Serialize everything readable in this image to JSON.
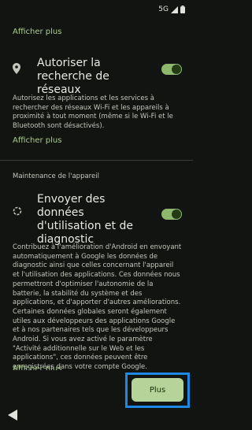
{
  "status_bar": {
    "network": "5G"
  },
  "links": {
    "show_more_top": "Afficher plus",
    "show_more_mid": "Afficher plus",
    "show_more_bottom": "Afficher plus"
  },
  "network_scan": {
    "title": "Autoriser la recherche de réseaux",
    "enabled": true,
    "description": "Autorisez les applications et les services à rechercher des réseaux Wi-Fi et les appareils à proximité à tout moment (même si le Wi-Fi et le Bluetooth sont désactivés)."
  },
  "maintenance": {
    "section_title": "Maintenance de l'appareil"
  },
  "diagnostics": {
    "title": "Envoyer des données d'utilisation et de diagnostic",
    "enabled": true,
    "description": "Contribuez à l'amélioration d'Android en envoyant automatiquement à Google les données de diagnostic ainsi que celles concernant l'appareil et l'utilisation des applications. Ces données nous permettront d'optimiser l'autonomie de la batterie, la stabilité du système et des applications, et d'apporter d'autres améliorations. Certaines données globales seront également utiles aux développeurs des applications Google et à nos partenaires tels que les développeurs Android. Si vous avez activé le paramètre \"Activité additionnelle sur le Web et les applications\", ces données peuvent être enregistrées dans votre compte Google."
  },
  "footer": {
    "more_button": "Plus"
  },
  "colors": {
    "accent": "#a8cf87",
    "toggle_on": "#8fb86f",
    "highlight": "#1e88e5",
    "background": "#111411"
  }
}
